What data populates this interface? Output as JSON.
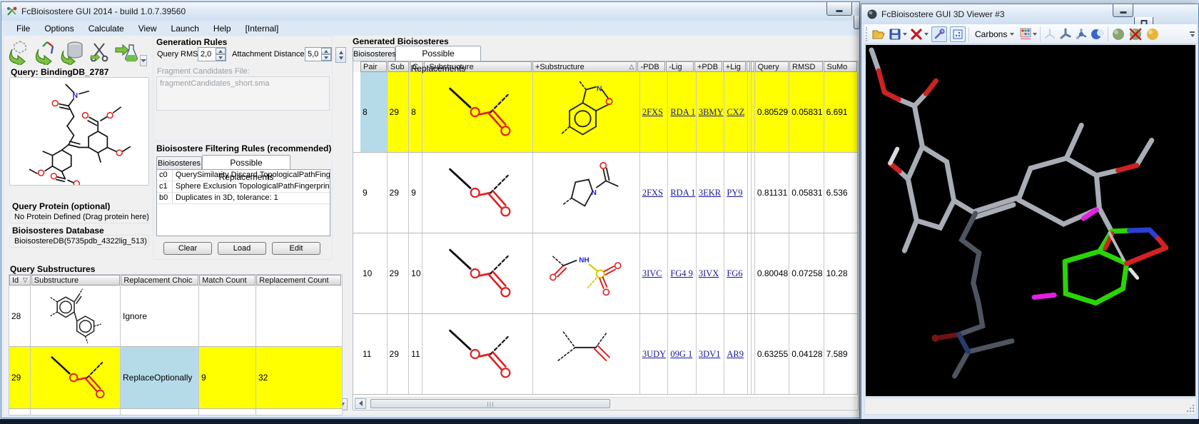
{
  "main_window": {
    "title": "FcBioisostere GUI 2014 - build 1.0.7.39560",
    "menu": [
      "File",
      "Options",
      "Calculate",
      "View",
      "Launch",
      "Help",
      "[Internal]"
    ],
    "query_panel": {
      "title": "Query: BindingDB_2787"
    },
    "generation_rules": {
      "title": "Generation Rules",
      "query_rmsd_label": "Query RMSD",
      "query_rmsd_value": "2,0",
      "attachment_distance_label": "Attachment Distance",
      "attachment_distance_value": "5,0",
      "fragment_file_label": "Fragment Candidates File:",
      "fragment_file_value": "fragmentCandidates_short.sma"
    },
    "filtering": {
      "title": "Bioisostere Filtering Rules (recommended)",
      "tabs": [
        "Bioisosteres",
        "Possible Replacements"
      ],
      "rules": [
        {
          "id": "c0",
          "text": "QuerySimilarity Discard TopologicalPathFingerprint"
        },
        {
          "id": "c1",
          "text": "Sphere Exclusion TopologicalPathFingerprint Tanim"
        },
        {
          "id": "b0",
          "text": "Duplicates in 3D, tolerance: 1"
        }
      ],
      "buttons": [
        "Clear",
        "Load",
        "Edit"
      ]
    },
    "protein": {
      "title": "Query Protein (optional)",
      "value": "No Protein Defined (Drag protein here)"
    },
    "database": {
      "title": "Bioisosteres Database",
      "value": "BioisostereDB(5735pdb_4322lig_513)"
    },
    "substructures": {
      "title": "Query Substructures",
      "columns": [
        "Id",
        "Substructure",
        "Replacement Choic",
        "Match Count",
        "Replacement Count"
      ],
      "rows": [
        {
          "id": "28",
          "choice": "Ignore",
          "match": "",
          "replacement": ""
        },
        {
          "id": "29",
          "choice": "ReplaceOptionally",
          "match": "9",
          "replacement": "32"
        }
      ]
    },
    "generated": {
      "title": "Generated Bioisosteres",
      "tabs": [
        "Bioisosteres",
        "Possible Replacements"
      ],
      "columns": [
        "Pair",
        "Sub",
        "C",
        "-Substructure",
        "+Substructure",
        "-PDB",
        "-Lig",
        "+PDB",
        "+Lig",
        "Query",
        "RMSD",
        "SuMo"
      ],
      "rows": [
        {
          "pair": "8",
          "sub": "29",
          "c": "8",
          "mpdb": "2FXS",
          "mlig": "RDA 1",
          "ppdb": "3BMY",
          "plig": "CXZ",
          "query": "0.80529",
          "rmsd": "0.05831",
          "sumo": "6.691"
        },
        {
          "pair": "9",
          "sub": "29",
          "c": "9",
          "mpdb": "2FXS",
          "mlig": "RDA 1",
          "ppdb": "3EKR",
          "plig": "PY9",
          "query": "0.81131",
          "rmsd": "0.05831",
          "sumo": "6.536"
        },
        {
          "pair": "10",
          "sub": "29",
          "c": "10",
          "mpdb": "3IVC",
          "mlig": "FG4 9",
          "ppdb": "3IVX",
          "plig": "FG6",
          "query": "0.80048",
          "rmsd": "0.07258",
          "sumo": "10.28"
        },
        {
          "pair": "11",
          "sub": "29",
          "c": "11",
          "mpdb": "3UDY",
          "mlig": "09G 1",
          "ppdb": "3DV1",
          "plig": "AR9",
          "query": "0.63255",
          "rmsd": "0.04128",
          "sumo": "7.589"
        }
      ]
    }
  },
  "viewer_window": {
    "title": "FcBioisostere GUI 3D Viewer #3",
    "carbons_label": "Carbons"
  },
  "icons": {
    "sort_desc": "▽",
    "sort_asc": "△"
  },
  "colors": {
    "highlight_yellow": "#ffff00",
    "selection_blue": "#b6dbe8",
    "fragment_green": "#2ad406",
    "attachment_magenta": "#e320e3"
  }
}
